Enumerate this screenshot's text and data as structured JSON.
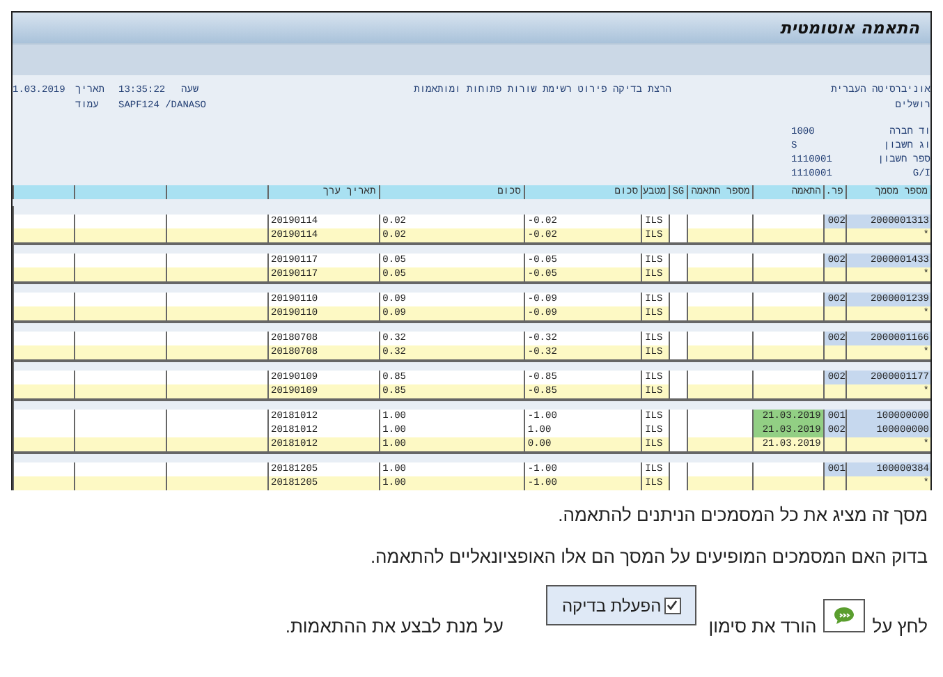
{
  "window": {
    "title": "התאמה אוטומטית"
  },
  "report": {
    "org_lines": [
      "אוניברסיטה העברית",
      "רושלים"
    ],
    "title": "הרצת בדיקה פירוט רשימת שורות פתוחות ומותאמות",
    "date_label": "תאריך",
    "date": "1.03.2019",
    "time_label": "שעה",
    "time": "13:35:22",
    "page_label": "עמוד",
    "user": "SAPF124 /DANASO",
    "fields": [
      {
        "label": "וד חברה",
        "value": "1000"
      },
      {
        "label": "וג חשבון",
        "value": "S"
      },
      {
        "label": "ספר חשבון",
        "value": "1110001"
      },
      {
        "label": "G/I",
        "value": "1110001"
      }
    ]
  },
  "table": {
    "columns": [
      "מספר מסמך",
      "פר.",
      "התאמה",
      "מספר התאמה",
      "SG",
      "מטבע",
      "סכום",
      "סכום",
      "תאריך ערך"
    ],
    "groups": [
      {
        "rows": [
          {
            "kind": "line",
            "doc": "2000001313",
            "item": "002",
            "currency": "ILS",
            "amount_1": "-0.02",
            "amount_2": "0.02",
            "value_date": "20190114"
          },
          {
            "kind": "total",
            "doc": "*",
            "currency": "ILS",
            "amount_1": "-0.02",
            "amount_2": "0.02",
            "value_date": "20190114"
          }
        ]
      },
      {
        "rows": [
          {
            "kind": "line",
            "doc": "2000001433",
            "item": "002",
            "currency": "ILS",
            "amount_1": "-0.05",
            "amount_2": "0.05",
            "value_date": "20190117"
          },
          {
            "kind": "total",
            "doc": "*",
            "currency": "ILS",
            "amount_1": "-0.05",
            "amount_2": "0.05",
            "value_date": "20190117"
          }
        ]
      },
      {
        "rows": [
          {
            "kind": "line",
            "doc": "2000001239",
            "item": "002",
            "currency": "ILS",
            "amount_1": "-0.09",
            "amount_2": "0.09",
            "value_date": "20190110"
          },
          {
            "kind": "total",
            "doc": "*",
            "currency": "ILS",
            "amount_1": "-0.09",
            "amount_2": "0.09",
            "value_date": "20190110"
          }
        ]
      },
      {
        "rows": [
          {
            "kind": "line",
            "doc": "2000001166",
            "item": "002",
            "currency": "ILS",
            "amount_1": "-0.32",
            "amount_2": "0.32",
            "value_date": "20180708"
          },
          {
            "kind": "total",
            "doc": "*",
            "currency": "ILS",
            "amount_1": "-0.32",
            "amount_2": "0.32",
            "value_date": "20180708"
          }
        ]
      },
      {
        "rows": [
          {
            "kind": "line",
            "doc": "2000001177",
            "item": "002",
            "currency": "ILS",
            "amount_1": "-0.85",
            "amount_2": "0.85",
            "value_date": "20190109"
          },
          {
            "kind": "total",
            "doc": "*",
            "currency": "ILS",
            "amount_1": "-0.85",
            "amount_2": "0.85",
            "value_date": "20190109"
          }
        ]
      },
      {
        "rows": [
          {
            "kind": "line",
            "doc": "100000000",
            "item": "001",
            "match": "21.03.2019",
            "matched": true,
            "currency": "ILS",
            "amount_1": "-1.00",
            "amount_2": "1.00",
            "value_date": "20181012"
          },
          {
            "kind": "line",
            "doc": "100000000",
            "item": "002",
            "match": "21.03.2019",
            "matched": true,
            "currency": "ILS",
            "amount_1": "1.00",
            "amount_2": "1.00",
            "value_date": "20181012"
          },
          {
            "kind": "total",
            "doc": "*",
            "match": "21.03.2019",
            "matched": false,
            "currency": "ILS",
            "amount_1": "0.00",
            "amount_2": "1.00",
            "value_date": "20181012"
          }
        ]
      },
      {
        "rows": [
          {
            "kind": "line",
            "doc": "100000384",
            "item": "001",
            "currency": "ILS",
            "amount_1": "-1.00",
            "amount_2": "1.00",
            "value_date": "20181205"
          },
          {
            "kind": "total",
            "doc": "*",
            "currency": "ILS",
            "amount_1": "-1.00",
            "amount_2": "1.00",
            "value_date": "20181205"
          }
        ]
      }
    ]
  },
  "instructions": {
    "paragraphs": [
      "מסך זה מציג את כל המסמכים הניתנים להתאמה.",
      "בדוק האם המסמכים המופיעים על המסך הם אלו האופציונאליים להתאמה."
    ],
    "step": {
      "before": "לחץ על",
      "middle": "הורד את סימון",
      "button_label": "הפעלת בדיקה",
      "button_checked": true,
      "after": "על מנת לבצע את ההתאמות."
    }
  }
}
